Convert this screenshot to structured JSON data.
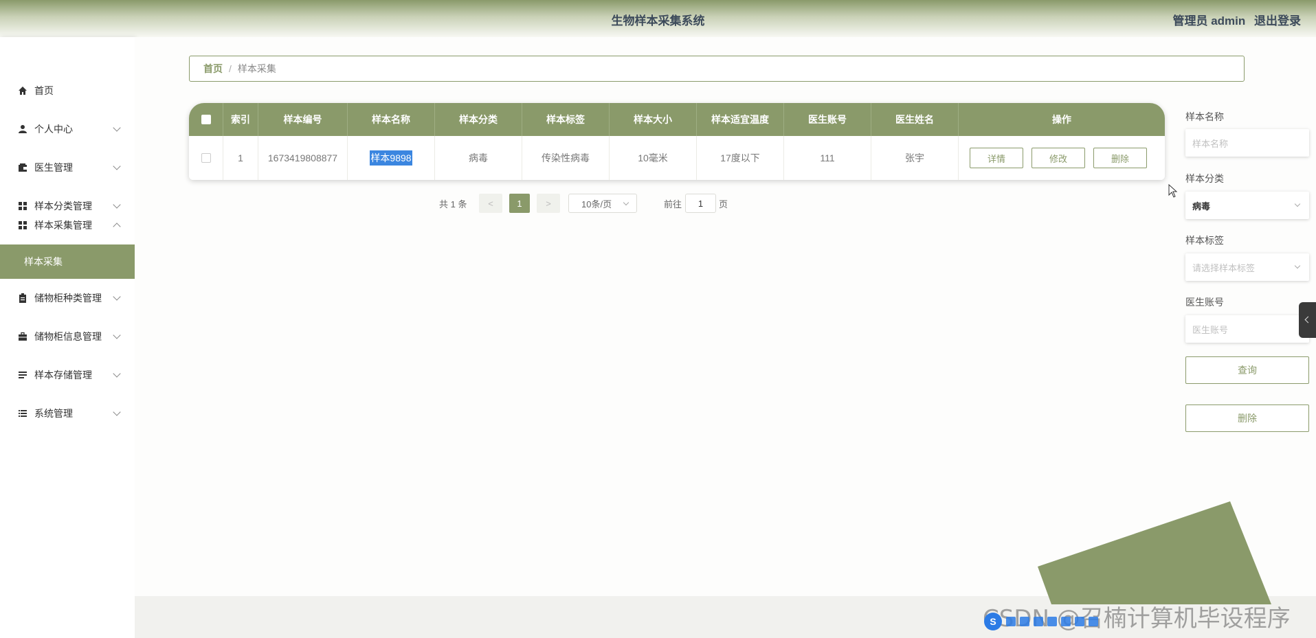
{
  "header": {
    "title": "生物样本采集系统",
    "user_label": "管理员 admin",
    "logout_label": "退出登录"
  },
  "sidebar": {
    "items": [
      {
        "label": "首页",
        "icon": "home-icon"
      },
      {
        "label": "个人中心",
        "icon": "user-icon"
      },
      {
        "label": "医生管理",
        "icon": "wallet-icon"
      },
      {
        "label": "样本分类管理",
        "icon": "grid-icon"
      },
      {
        "label": "样本采集管理",
        "icon": "grid-icon"
      },
      {
        "label": "储物柜种类管理",
        "icon": "clipboard-icon"
      },
      {
        "label": "储物柜信息管理",
        "icon": "briefcase-icon"
      },
      {
        "label": "样本存储管理",
        "icon": "list-icon"
      },
      {
        "label": "系统管理",
        "icon": "list-icon"
      }
    ],
    "active_sub": "样本采集"
  },
  "breadcrumb": {
    "home": "首页",
    "separator": "/",
    "current": "样本采集"
  },
  "table": {
    "columns": [
      "索引",
      "样本编号",
      "样本名称",
      "样本分类",
      "样本标签",
      "样本大小",
      "样本适宜温度",
      "医生账号",
      "医生姓名",
      "操作"
    ],
    "rows": [
      {
        "index": "1",
        "code": "1673419808877",
        "name": "样本9898",
        "category": "病毒",
        "tag": "传染性病毒",
        "size": "10毫米",
        "temp": "17度以下",
        "doctor_account": "111",
        "doctor_name": "张宇"
      }
    ],
    "actions": {
      "detail": "详情",
      "edit": "修改",
      "delete": "删除"
    }
  },
  "pagination": {
    "total": "共 1 条",
    "prev": "<",
    "current_page": "1",
    "next": ">",
    "page_size": "10条/页",
    "goto_label": "前往",
    "goto_value": "1",
    "page_suffix": "页"
  },
  "search_panel": {
    "name_label": "样本名称",
    "name_placeholder": "样本名称",
    "category_label": "样本分类",
    "category_value": "病毒",
    "tag_label": "样本标签",
    "tag_placeholder": "请选择样本标签",
    "doctor_label": "医生账号",
    "doctor_placeholder": "医生账号",
    "query_button": "查询",
    "delete_button": "删除"
  },
  "watermark": "CSDN @召楠计算机毕设程序",
  "colors": {
    "accent": "#8a9a6a",
    "selection": "#3b86e0"
  }
}
